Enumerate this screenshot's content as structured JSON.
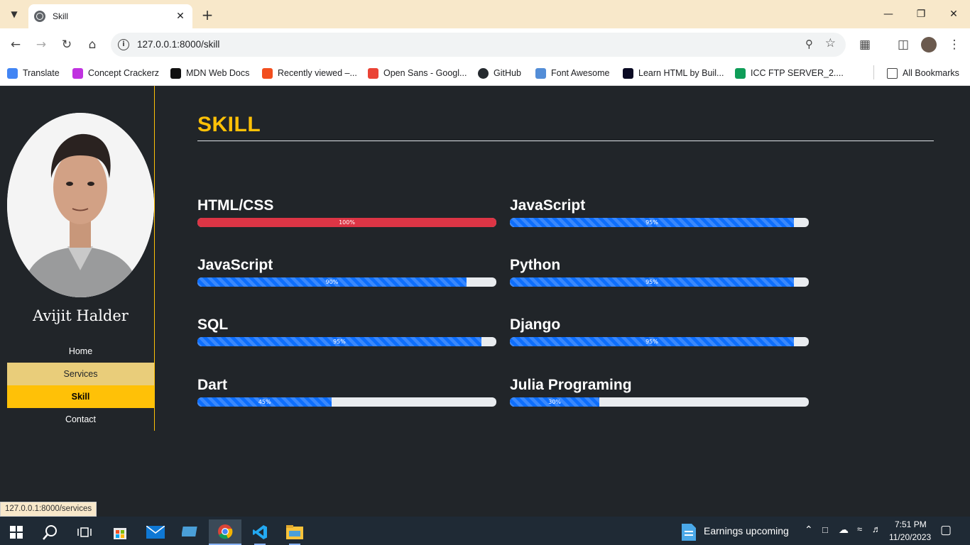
{
  "browser": {
    "tab_title": "Skill",
    "url": "127.0.0.1:8000/skill",
    "bookmarks": [
      {
        "label": "Translate",
        "color": "#4285f4"
      },
      {
        "label": "Concept Crackerz",
        "color": "#c032e0"
      },
      {
        "label": "MDN Web Docs",
        "color": "#111111"
      },
      {
        "label": "Recently viewed –...",
        "color": "#f24e1e"
      },
      {
        "label": "Open Sans - Googl...",
        "color": "#ea4335"
      },
      {
        "label": "GitHub",
        "color": "#24292e"
      },
      {
        "label": "Font Awesome",
        "color": "#538dd7"
      },
      {
        "label": "Learn HTML by Buil...",
        "color": "#0a0a23"
      },
      {
        "label": "ICC FTP SERVER_2....",
        "color": "#0f9d58"
      }
    ],
    "all_bookmarks": "All Bookmarks",
    "status_url": "127.0.0.1:8000/services"
  },
  "sidebar": {
    "name": "Avijit Halder",
    "nav": [
      "Home",
      "Services",
      "Skill",
      "Contact"
    ]
  },
  "main": {
    "heading": "SKILL",
    "skills": [
      {
        "name": "HTML/CSS",
        "label": "100%",
        "percent": 100,
        "color": "red"
      },
      {
        "name": "JavaScript",
        "label": "95%",
        "percent": 95,
        "color": "blue"
      },
      {
        "name": "JavaScript",
        "label": "90%",
        "percent": 90,
        "color": "blue"
      },
      {
        "name": "Python",
        "label": "95%",
        "percent": 95,
        "color": "blue"
      },
      {
        "name": "SQL",
        "label": "95%",
        "percent": 95,
        "color": "blue"
      },
      {
        "name": "Django",
        "label": "95%",
        "percent": 95,
        "color": "blue"
      },
      {
        "name": "Dart",
        "label": "45%",
        "percent": 45,
        "color": "blue"
      },
      {
        "name": "Julia Programing",
        "label": "30%",
        "percent": 30,
        "color": "blue"
      }
    ]
  },
  "taskbar": {
    "news": "Earnings upcoming",
    "time": "7:51 PM",
    "date": "11/20/2023"
  }
}
